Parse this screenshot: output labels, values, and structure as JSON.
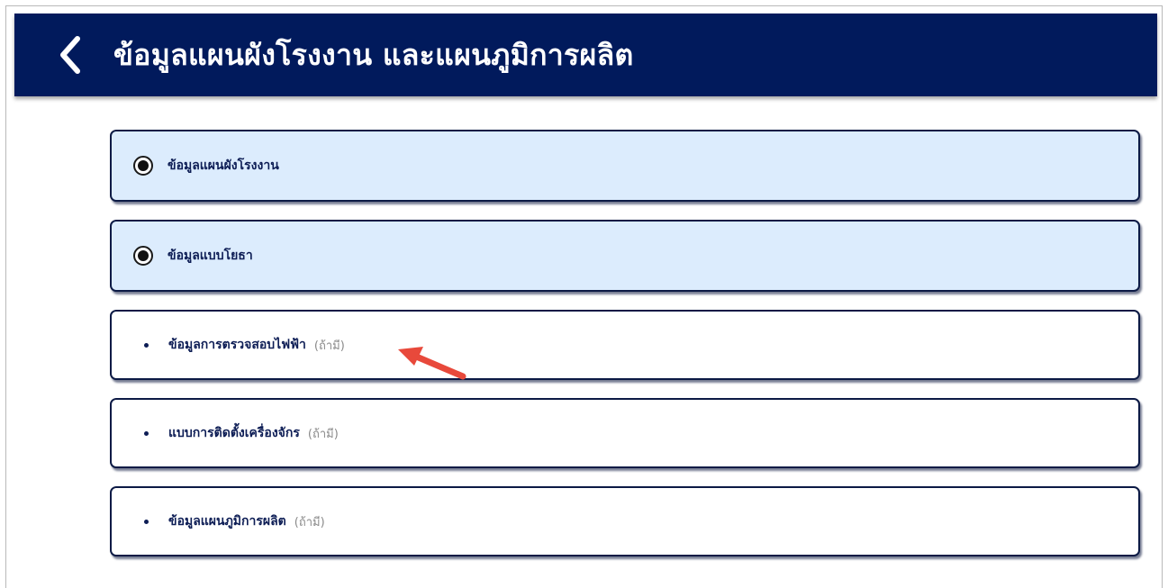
{
  "header": {
    "title": "ข้อมูลแผนผังโรงงาน และแผนภูมิการผลิต",
    "back_icon": "chevron-left-icon",
    "background": "#011a5c"
  },
  "options": [
    {
      "label": "ข้อมูลแผนผังโรงงาน",
      "selected": true
    },
    {
      "label": "ข้อมูลแบบโยธา",
      "selected": true
    }
  ],
  "documents": [
    {
      "label": "ข้อมูลการตรวจสอบไฟฟ้า",
      "note": "(ถ้ามี)"
    },
    {
      "label": "แบบการติดตั้งเครื่องจักร",
      "note": "(ถ้ามี)"
    },
    {
      "label": "ข้อมูลแผนภูมิการผลิต",
      "note": "(ถ้ามี)"
    }
  ],
  "colors": {
    "selected_card": "#dcecfd",
    "card_border": "#0c1a45",
    "annotation_arrow": "#e8493b"
  },
  "annotation": {
    "icon": "red-arrow-icon"
  }
}
